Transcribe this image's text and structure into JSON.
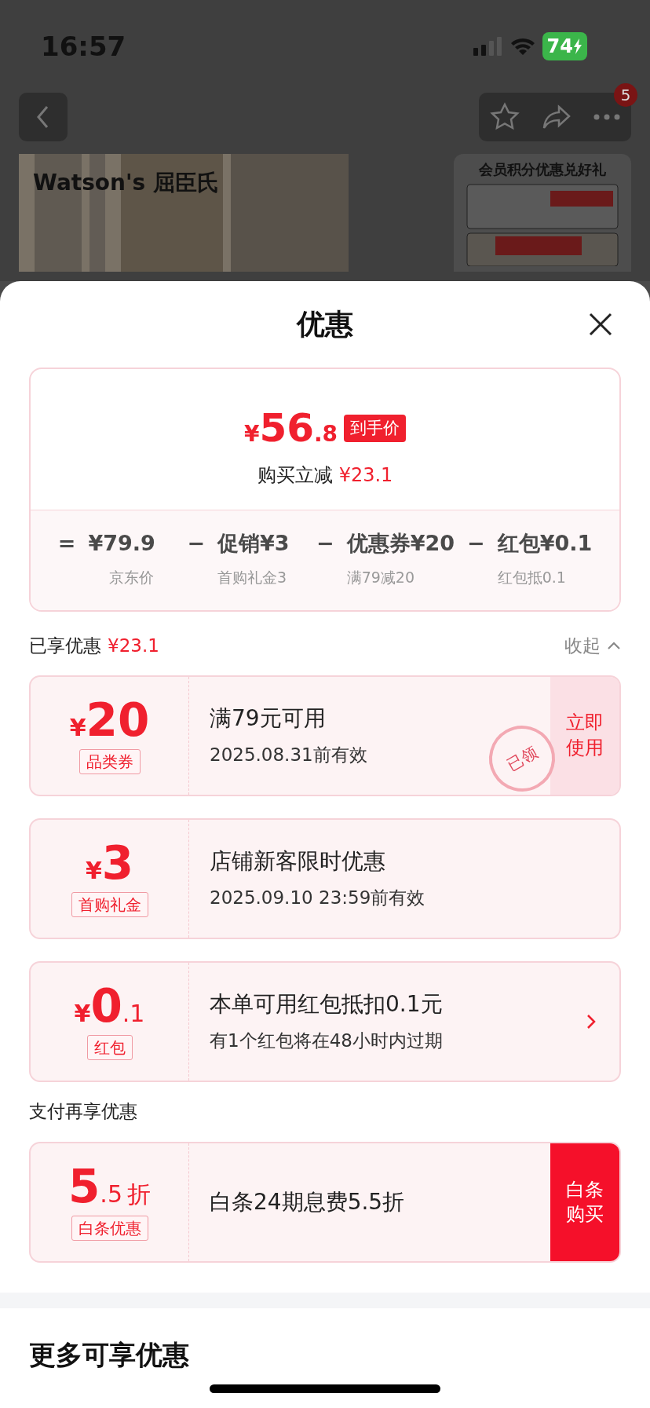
{
  "status_bar": {
    "time": "16:57",
    "battery": "74",
    "charging": true
  },
  "background_page": {
    "badge": "5",
    "banner_brand": "Watson's 屈臣氏",
    "side_title": "会员积分优惠兑好礼"
  },
  "sheet": {
    "title": "优惠"
  },
  "summary": {
    "currency": "¥",
    "price_int": "56",
    "price_dec": ".8",
    "price_tag": "到手价",
    "saving_label": "购买立减",
    "saving": "¥23.1",
    "breakdown": [
      {
        "op": "=",
        "amount": "¥79.9",
        "note": "京东价"
      },
      {
        "op": "−",
        "amount": "促销¥3",
        "note": "首购礼金3"
      },
      {
        "op": "−",
        "amount": "优惠券¥20",
        "note": "满79减20"
      },
      {
        "op": "−",
        "amount": "红包¥0.1",
        "note": "红包抵0.1"
      }
    ]
  },
  "enjoyed": {
    "label": "已享优惠",
    "amount": "¥23.1",
    "toggle": "收起",
    "expanded": true
  },
  "coupons": [
    {
      "currency": "¥",
      "int": "20",
      "tag": "品类券",
      "title": "满79元可用",
      "subtitle": "2025.08.31前有效",
      "stamp": "已领",
      "action": {
        "kind": "soft",
        "text": "立即使用"
      }
    },
    {
      "currency": "¥",
      "int": "3",
      "tag": "首购礼金",
      "title": "店铺新客限时优惠",
      "subtitle": "2025.09.10 23:59前有效"
    },
    {
      "currency": "¥",
      "int": "0",
      "dec": ".1",
      "tag": "红包",
      "title": "本单可用红包抵扣0.1元",
      "subtitle": "有1个红包将在48小时内过期",
      "action": {
        "kind": "chevron"
      }
    }
  ],
  "pay_section": {
    "label": "支付再享优惠"
  },
  "pay_coupons": [
    {
      "int": "5",
      "dec": ".5",
      "unit": "折",
      "tag": "白条优惠",
      "title": "白条24期息费5.5折",
      "action": {
        "kind": "solid",
        "text": "白条购买"
      }
    }
  ],
  "more_section": {
    "label": "更多可享优惠"
  }
}
